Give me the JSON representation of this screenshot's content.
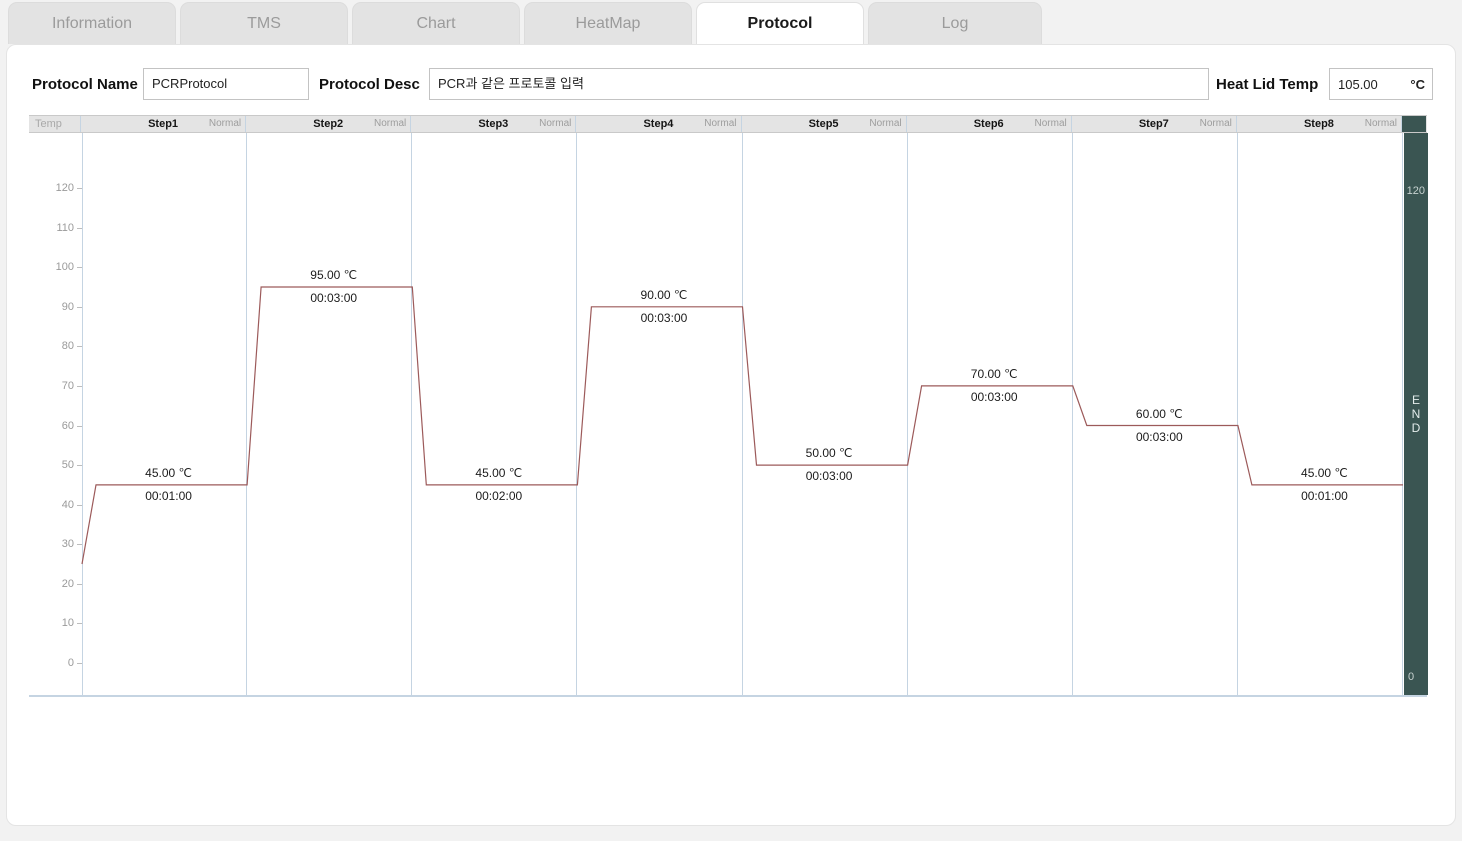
{
  "tabs": [
    {
      "label": "Information",
      "active": false
    },
    {
      "label": "TMS",
      "active": false
    },
    {
      "label": "Chart",
      "active": false
    },
    {
      "label": "HeatMap",
      "active": false
    },
    {
      "label": "Protocol",
      "active": true
    },
    {
      "label": "Log",
      "active": false
    }
  ],
  "form": {
    "protocol_name_label": "Protocol Name",
    "protocol_name_value": "PCRProtocol",
    "protocol_desc_label": "Protocol Desc",
    "protocol_desc_value": "PCR과 같은 프로토콜 입력",
    "heat_lid_label": "Heat Lid Temp",
    "heat_lid_value": "105.00",
    "heat_lid_unit": "°C"
  },
  "chart_header": {
    "temp_label": "Temp",
    "end_label": "E\nN\nD"
  },
  "end_bar": {
    "top_value": "120",
    "bottom_value": "0",
    "letters": [
      "E",
      "N",
      "D"
    ]
  },
  "colors": {
    "line": "#9c5a5a",
    "grid": "#c5d4e2",
    "end_bar": "#3a5552",
    "header_bg": "#e4e4e4",
    "tab_inactive": "#e3e3e3",
    "tab_active": "#ffffff",
    "axis_text": "#9a9a9a"
  },
  "chart_data": {
    "type": "line",
    "title": "",
    "xlabel": "",
    "ylabel": "Temp",
    "ylim": [
      0,
      127
    ],
    "yticks": [
      0,
      10,
      20,
      30,
      40,
      50,
      60,
      70,
      80,
      90,
      100,
      110,
      120
    ],
    "grid": true,
    "legend": "none",
    "start_temp": 25.0,
    "categories": [
      "Step1",
      "Step2",
      "Step3",
      "Step4",
      "Step5",
      "Step6",
      "Step7",
      "Step8"
    ],
    "modes": [
      "Normal",
      "Normal",
      "Normal",
      "Normal",
      "Normal",
      "Normal",
      "Normal",
      "Normal"
    ],
    "values": [
      45.0,
      95.0,
      45.0,
      90.0,
      50.0,
      70.0,
      60.0,
      45.0
    ],
    "steps": [
      {
        "name": "Step1",
        "mode": "Normal",
        "temp": 45.0,
        "temp_label": "45.00 ℃",
        "time": "00:01:00"
      },
      {
        "name": "Step2",
        "mode": "Normal",
        "temp": 95.0,
        "temp_label": "95.00 ℃",
        "time": "00:03:00"
      },
      {
        "name": "Step3",
        "mode": "Normal",
        "temp": 45.0,
        "temp_label": "45.00 ℃",
        "time": "00:02:00"
      },
      {
        "name": "Step4",
        "mode": "Normal",
        "temp": 90.0,
        "temp_label": "90.00 ℃",
        "time": "00:03:00"
      },
      {
        "name": "Step5",
        "mode": "Normal",
        "temp": 50.0,
        "temp_label": "50.00 ℃",
        "time": "00:03:00"
      },
      {
        "name": "Step6",
        "mode": "Normal",
        "temp": 70.0,
        "temp_label": "70.00 ℃",
        "time": "00:03:00"
      },
      {
        "name": "Step7",
        "mode": "Normal",
        "temp": 60.0,
        "temp_label": "60.00 ℃",
        "time": "00:03:00"
      },
      {
        "name": "Step8",
        "mode": "Normal",
        "temp": 45.0,
        "temp_label": "45.00 ℃",
        "time": "00:01:00"
      }
    ]
  }
}
